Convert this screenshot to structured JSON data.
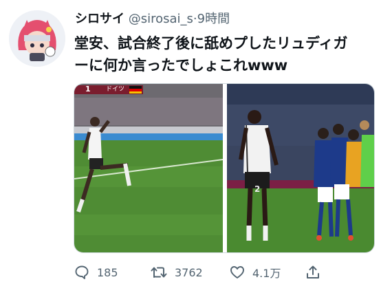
{
  "tweet": {
    "display_name": "シロサイ",
    "handle": "@sirosai_s",
    "separator": "·",
    "time": "9時間",
    "text_line1": "堂安、試合終了後に舐めプしたリュディガ",
    "text_line2": "ーに何か言ったでしょこれwww"
  },
  "media": {
    "scoreboard_number": "1",
    "scoreboard_team": "ドイツ",
    "jersey_number": "2"
  },
  "actions": {
    "reply_count": "185",
    "retweet_count": "3762",
    "like_count": "4.1万"
  },
  "colors": {
    "text": "#0f1419",
    "secondary": "#536471",
    "pitch": "#4f8c34",
    "japan_blue": "#1d3a8a"
  },
  "icons": [
    "reply-icon",
    "retweet-icon",
    "like-icon",
    "share-icon"
  ]
}
